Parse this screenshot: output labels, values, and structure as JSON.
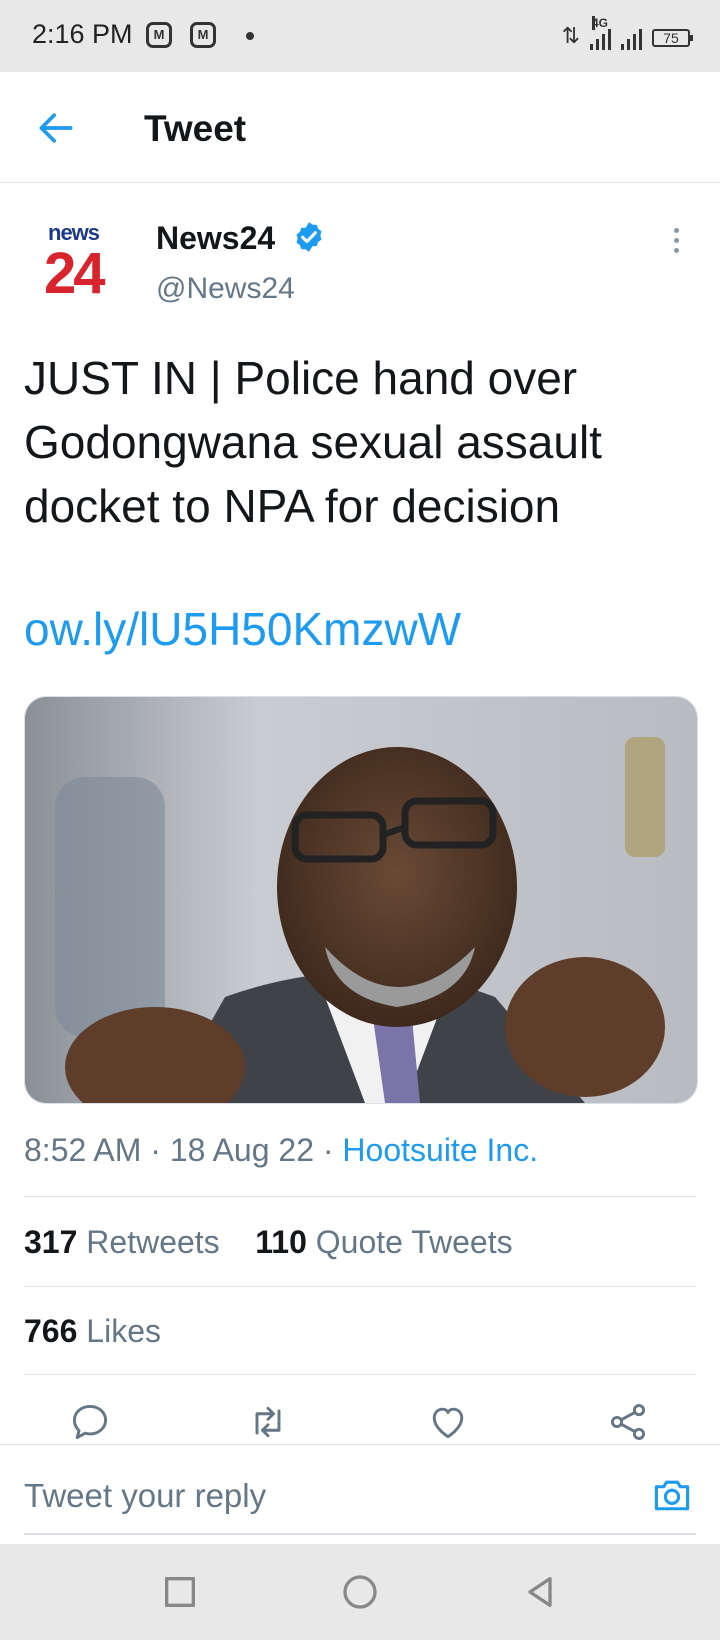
{
  "status_bar": {
    "time": "2:16 PM",
    "notif1": "M",
    "notif2": "M",
    "network": "4G",
    "battery": "75"
  },
  "header": {
    "title": "Tweet",
    "back_icon": "arrow-left-icon"
  },
  "author": {
    "avatar_news": "news",
    "avatar_num": "24",
    "name": "News24",
    "handle": "@News24",
    "verified_icon": "verified-badge-icon"
  },
  "tweet": {
    "text": "JUST IN | Police hand over Godongwana sexual assault docket to NPA for decision",
    "link": "ow.ly/lU5H50KmzwW",
    "time": "8:52 AM",
    "date": "18 Aug 22",
    "source": "Hootsuite Inc.",
    "sep": "·"
  },
  "stats": {
    "retweets_count": "317",
    "retweets_label": "Retweets",
    "quotes_count": "110",
    "quotes_label": "Quote Tweets",
    "likes_count": "766",
    "likes_label": "Likes"
  },
  "actions": {
    "reply_icon": "comment-icon",
    "retweet_icon": "retweet-icon",
    "like_icon": "heart-icon",
    "share_icon": "share-icon"
  },
  "reply": {
    "placeholder": "Tweet your reply",
    "camera_icon": "camera-icon"
  },
  "colors": {
    "accent": "#1d9bf0",
    "muted": "#657786",
    "logo_red": "#d9232d",
    "logo_blue": "#1d3a8a"
  }
}
